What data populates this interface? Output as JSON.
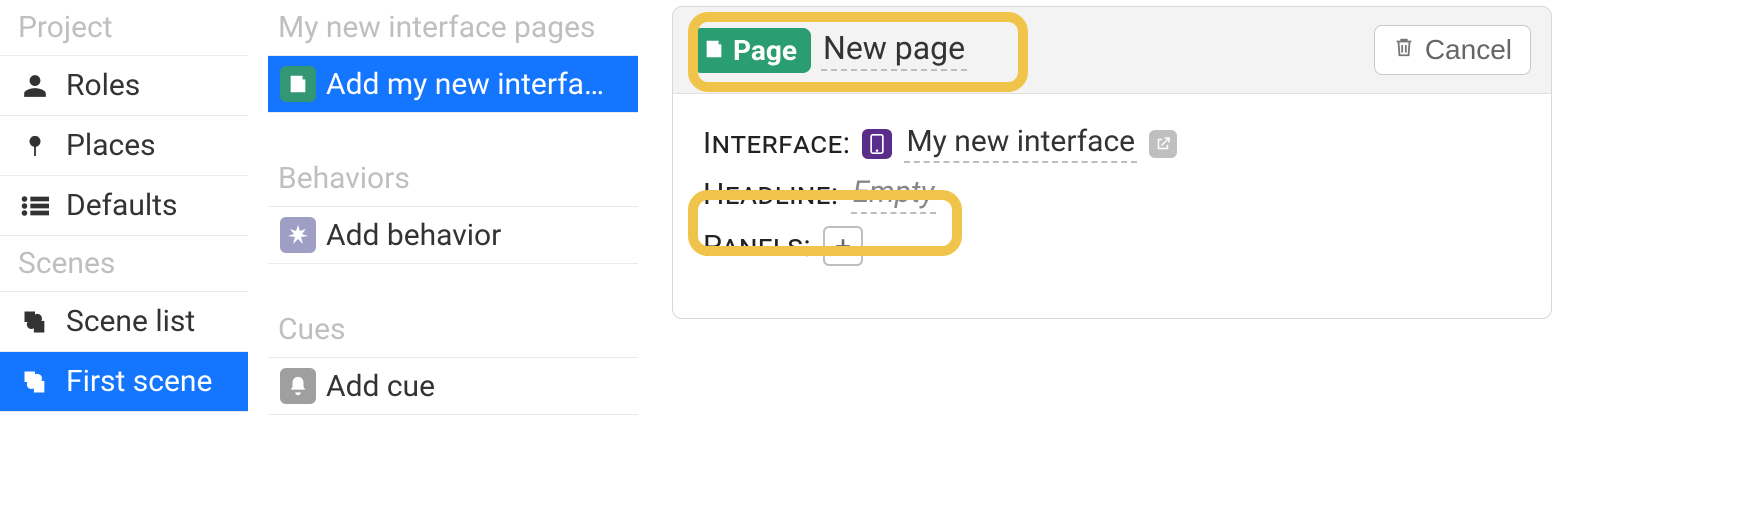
{
  "nav1": {
    "heading1": "Project",
    "items1": [
      {
        "label": "Roles",
        "icon": "person"
      },
      {
        "label": "Places",
        "icon": "pin"
      },
      {
        "label": "Defaults",
        "icon": "list"
      }
    ],
    "heading2": "Scenes",
    "items2": [
      {
        "label": "Scene list",
        "icon": "puzzle"
      },
      {
        "label": "First scene",
        "icon": "puzzle",
        "selected": true
      }
    ]
  },
  "nav2": {
    "heading1": "My new interface pages",
    "item1": {
      "label": "Add my new interfa…",
      "selected": true
    },
    "heading2": "Behaviors",
    "item2": {
      "label": "Add behavior"
    },
    "heading3": "Cues",
    "item3": {
      "label": "Add cue"
    }
  },
  "detail": {
    "page_badge_label": "Page",
    "page_title": "New page",
    "cancel_label": "Cancel",
    "interface_label": "Interface:",
    "interface_name": "My new interface",
    "headline_label": "Headline:",
    "headline_value": "Empty",
    "panels_label": "Panels:"
  }
}
